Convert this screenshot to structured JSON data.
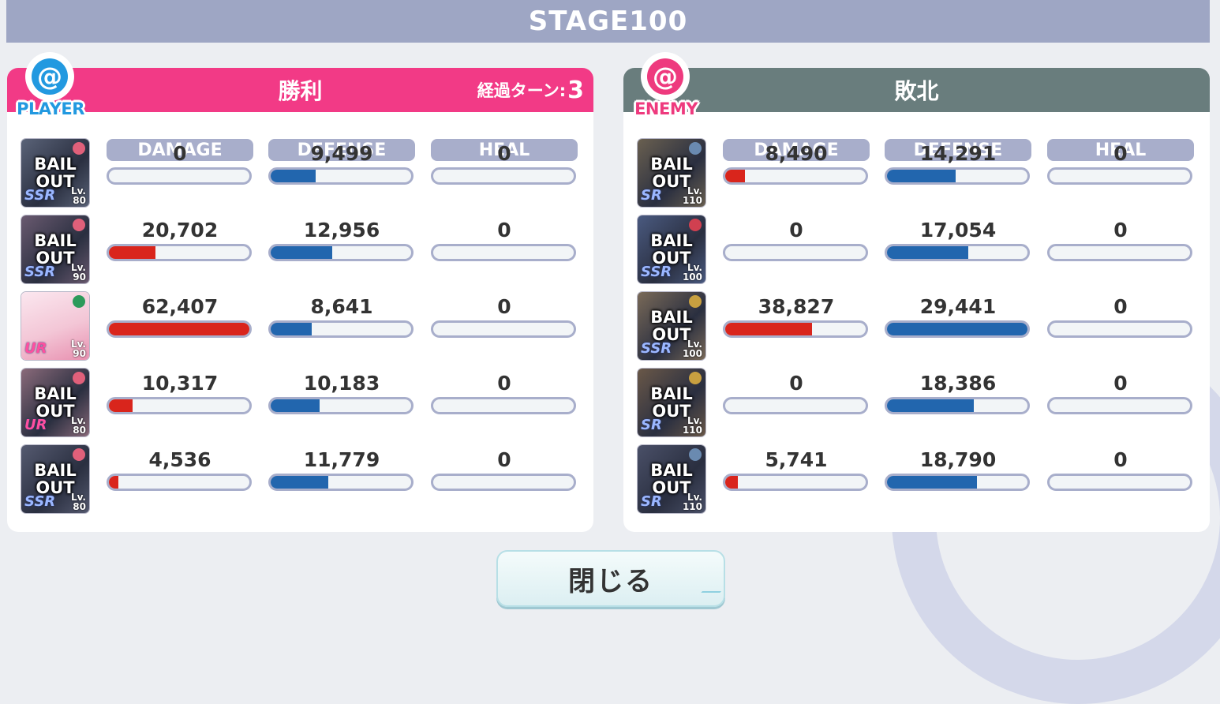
{
  "stage": "STAGE100",
  "player": {
    "badge": "PLAYER",
    "result": "勝利",
    "turn_label": "経過ターン:",
    "turn_value": "3",
    "columns": [
      "DAMAGE",
      "DEFENSE",
      "HEAL"
    ],
    "rows": [
      {
        "bail_line1": "BAIL",
        "bail_line2": "OUT",
        "rarity": "SSR",
        "level_label": "Lv.",
        "level": "80",
        "damage": "0",
        "defense": "9,499",
        "heal": "0",
        "damage_ratio": 0.0,
        "defense_ratio": 0.32,
        "heal_ratio": 0.0,
        "bail": true
      },
      {
        "bail_line1": "BAIL",
        "bail_line2": "OUT",
        "rarity": "SSR",
        "level_label": "Lv.",
        "level": "90",
        "damage": "20,702",
        "defense": "12,956",
        "heal": "0",
        "damage_ratio": 0.33,
        "defense_ratio": 0.44,
        "heal_ratio": 0.0,
        "bail": true
      },
      {
        "bail_line1": "",
        "bail_line2": "",
        "rarity": "UR",
        "level_label": "Lv.",
        "level": "90",
        "damage": "62,407",
        "defense": "8,641",
        "heal": "0",
        "damage_ratio": 1.0,
        "defense_ratio": 0.29,
        "heal_ratio": 0.0,
        "bail": false
      },
      {
        "bail_line1": "BAIL",
        "bail_line2": "OUT",
        "rarity": "UR",
        "level_label": "Lv.",
        "level": "80",
        "damage": "10,317",
        "defense": "10,183",
        "heal": "0",
        "damage_ratio": 0.17,
        "defense_ratio": 0.35,
        "heal_ratio": 0.0,
        "bail": true
      },
      {
        "bail_line1": "BAIL",
        "bail_line2": "OUT",
        "rarity": "SSR",
        "level_label": "Lv.",
        "level": "80",
        "damage": "4,536",
        "defense": "11,779",
        "heal": "0",
        "damage_ratio": 0.07,
        "defense_ratio": 0.41,
        "heal_ratio": 0.0,
        "bail": true
      }
    ]
  },
  "enemy": {
    "badge": "ENEMY",
    "result": "敗北",
    "columns": [
      "DAMAGE",
      "DEFENSE",
      "HEAL"
    ],
    "rows": [
      {
        "bail_line1": "BAIL",
        "bail_line2": "OUT",
        "rarity": "SR",
        "level_label": "Lv.",
        "level": "110",
        "damage": "8,490",
        "defense": "14,291",
        "heal": "0",
        "damage_ratio": 0.14,
        "defense_ratio": 0.49,
        "heal_ratio": 0.0,
        "bail": true
      },
      {
        "bail_line1": "BAIL",
        "bail_line2": "OUT",
        "rarity": "SSR",
        "level_label": "Lv.",
        "level": "100",
        "damage": "0",
        "defense": "17,054",
        "heal": "0",
        "damage_ratio": 0.0,
        "defense_ratio": 0.58,
        "heal_ratio": 0.0,
        "bail": true
      },
      {
        "bail_line1": "BAIL",
        "bail_line2": "OUT",
        "rarity": "SSR",
        "level_label": "Lv.",
        "level": "100",
        "damage": "38,827",
        "defense": "29,441",
        "heal": "0",
        "damage_ratio": 0.62,
        "defense_ratio": 1.0,
        "heal_ratio": 0.0,
        "bail": true
      },
      {
        "bail_line1": "BAIL",
        "bail_line2": "OUT",
        "rarity": "SR",
        "level_label": "Lv.",
        "level": "110",
        "damage": "0",
        "defense": "18,386",
        "heal": "0",
        "damage_ratio": 0.0,
        "defense_ratio": 0.62,
        "heal_ratio": 0.0,
        "bail": true
      },
      {
        "bail_line1": "BAIL",
        "bail_line2": "OUT",
        "rarity": "SR",
        "level_label": "Lv.",
        "level": "110",
        "damage": "5,741",
        "defense": "18,790",
        "heal": "0",
        "damage_ratio": 0.09,
        "defense_ratio": 0.64,
        "heal_ratio": 0.0,
        "bail": true
      }
    ]
  },
  "close_label": "閉じる",
  "colors": {
    "player_header": "#f23a86",
    "enemy_header": "#697d7d",
    "damage_bar": "#d9251c",
    "defense_bar": "#2266ae",
    "column_header": "#a8aecb"
  }
}
